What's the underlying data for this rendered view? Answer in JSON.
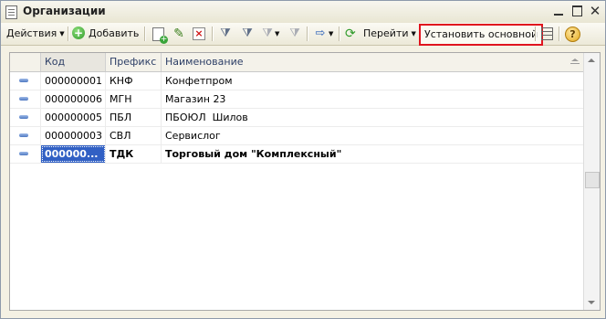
{
  "window": {
    "title": "Организации"
  },
  "toolbar": {
    "actions_label": "Действия",
    "add_label": "Добавить",
    "goto_label": "Перейти",
    "set_main_label": "Установить основной"
  },
  "table": {
    "columns": {
      "code": "Код",
      "prefix": "Префикс",
      "name": "Наименование"
    },
    "rows": [
      {
        "code": "000000001",
        "prefix": "КНФ",
        "name": "Конфетпром"
      },
      {
        "code": "000000006",
        "prefix": "МГН",
        "name": "Магазин 23"
      },
      {
        "code": "000000005",
        "prefix": "ПБЛ",
        "name": "ПБОЮЛ  Шилов"
      },
      {
        "code": "000000003",
        "prefix": "СВЛ",
        "name": "Сервислог"
      },
      {
        "code": "000000...",
        "prefix": "ТДК",
        "name": "Торговый дом \"Комплексный\""
      }
    ],
    "selected_row": 5
  },
  "colors": {
    "highlight_border": "#e0141e",
    "selection": "#3160c4"
  }
}
